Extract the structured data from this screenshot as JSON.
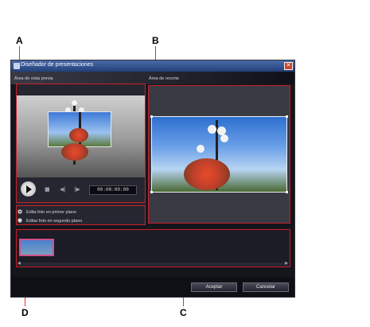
{
  "callouts": {
    "a": "A",
    "b": "B",
    "c": "C",
    "d": "D"
  },
  "window": {
    "title": "Diseñador de presentaciones",
    "close_glyph": "✕"
  },
  "labels": {
    "preview_area": "Área de vista previa",
    "crop_area": "Área de recorte"
  },
  "playback": {
    "timecode": "00:00:00:00",
    "play_icon": "play-icon",
    "stop_icon": "stop-icon",
    "prev_icon": "prev-frame-icon",
    "next_icon": "next-frame-icon"
  },
  "options": {
    "foreground": "Edita foto en primer plano",
    "background": "Editar foto en segundo plano",
    "selected": "foreground"
  },
  "buttons": {
    "accept": "Aceptar",
    "cancel": "Cancelar"
  },
  "colors": {
    "highlight_border": "#c8202a",
    "title_bar": "#2f4f8f",
    "thumb_border": "#d0508a"
  }
}
